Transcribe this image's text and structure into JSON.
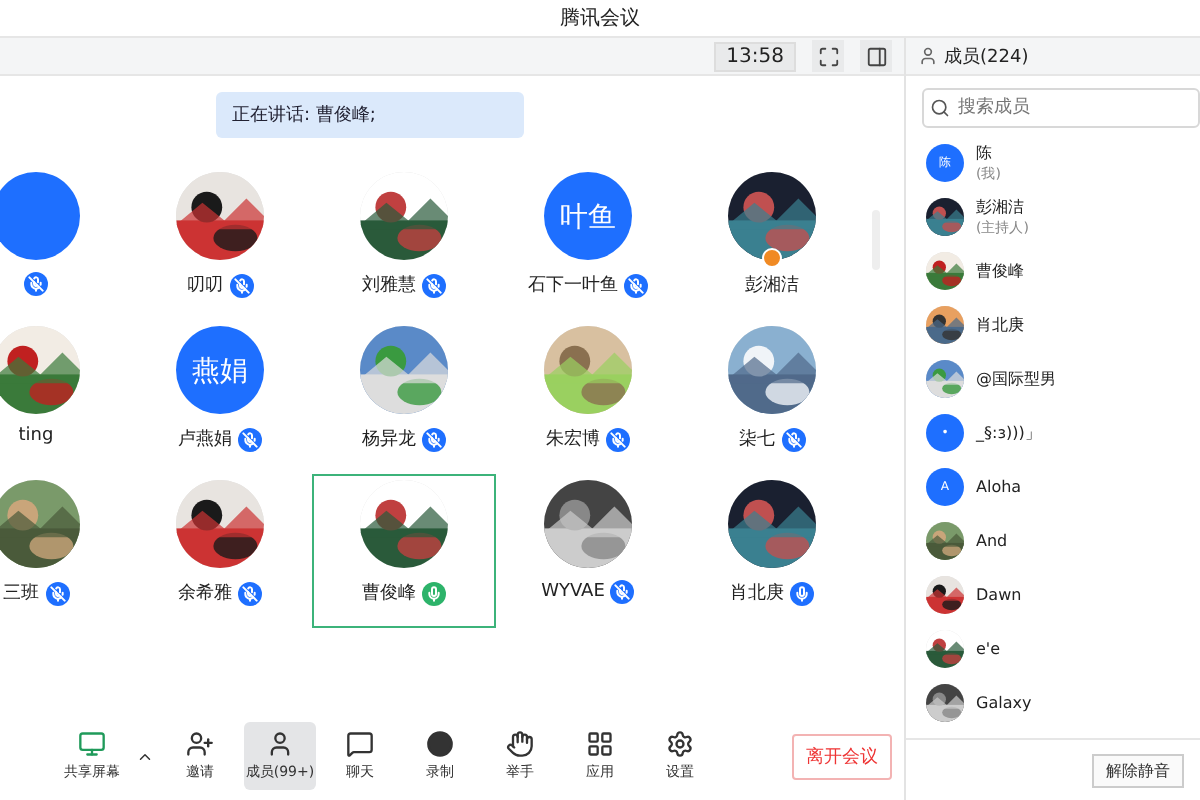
{
  "window": {
    "title": "腾讯会议"
  },
  "top_bar": {
    "time": "13:58"
  },
  "speaking_banner": "正在讲话: 曹俊峰;",
  "participants": [
    {
      "avatar": {
        "kind": "letter"
      },
      "mic": {
        "muted": true,
        "speaking": false
      },
      "selected": false
    },
    {
      "name": "叨叨",
      "mic": {
        "muted": true,
        "speaking": false
      },
      "selected": false
    },
    {
      "name": "刘雅慧",
      "mic": {
        "muted": true,
        "speaking": false
      },
      "selected": false
    },
    {
      "name": "石下一叶鱼",
      "avatar": {
        "kind": "letter",
        "text": "叶鱼"
      },
      "mic": {
        "muted": true,
        "speaking": false
      },
      "selected": false
    },
    {
      "name": "彭湘洁",
      "host": true,
      "selected": false
    },
    {
      "name": "ting",
      "selected": false
    },
    {
      "name": "卢燕娟",
      "avatar": {
        "kind": "letter",
        "text": "燕娟"
      },
      "mic": {
        "muted": true,
        "speaking": false
      },
      "selected": false
    },
    {
      "name": "杨异龙",
      "mic": {
        "muted": true,
        "speaking": false
      },
      "selected": false
    },
    {
      "name": "朱宏博",
      "mic": {
        "muted": true,
        "speaking": false
      },
      "selected": false
    },
    {
      "name": "柒七",
      "mic": {
        "muted": true,
        "speaking": false
      },
      "selected": false
    },
    {
      "name": "三班",
      "mic": {
        "muted": true,
        "speaking": false
      },
      "selected": false
    },
    {
      "name": "余希雅",
      "mic": {
        "muted": true,
        "speaking": false
      },
      "selected": false
    },
    {
      "name": "曹俊峰",
      "mic": {
        "muted": false,
        "speaking": true
      },
      "selected": true
    },
    {
      "name": "WYVAE",
      "mic": {
        "muted": true,
        "speaking": false
      },
      "selected": false
    },
    {
      "name": "肖北庚",
      "mic": {
        "muted": false,
        "speaking": false
      },
      "selected": false
    }
  ],
  "toolbar": [
    {
      "label": "共享屏幕",
      "selected": false
    },
    {
      "label": "邀请",
      "selected": false
    },
    {
      "label": "成员(99+)",
      "selected": true
    },
    {
      "label": "聊天",
      "selected": false
    },
    {
      "label": "录制",
      "selected": false
    },
    {
      "label": "举手",
      "selected": false
    },
    {
      "label": "应用",
      "selected": false
    },
    {
      "label": "设置",
      "selected": false
    }
  ],
  "leave_button": "离开会议",
  "members_panel": {
    "title": "成员(224)",
    "search": {
      "placeholder": "搜索成员"
    },
    "members": [
      {
        "name": "陈",
        "note": "(我)",
        "avatar": {
          "kind": "letter",
          "text": "陈"
        }
      },
      {
        "name": "彭湘洁",
        "note": "(主持人)"
      },
      {
        "name": "曹俊峰"
      },
      {
        "name": "肖北庚"
      },
      {
        "name": "@国际型男"
      },
      {
        "name": "_§:з)))」",
        "avatar": {
          "kind": "letter",
          "text": "•"
        }
      },
      {
        "name": "Aloha",
        "avatar": {
          "kind": "letter",
          "text": "A"
        }
      },
      {
        "name": "And"
      },
      {
        "name": "Dawn"
      },
      {
        "name": "e'e"
      },
      {
        "name": "Galaxy"
      }
    ],
    "unmute_button": "解除静音"
  }
}
